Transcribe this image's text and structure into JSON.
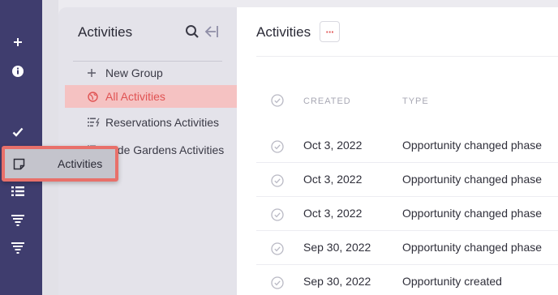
{
  "rail": {
    "icons": [
      "plus-icon",
      "info-icon",
      "check-icon",
      "note-icon",
      "list-icon",
      "filter-icon",
      "filter-icon"
    ]
  },
  "sidebar": {
    "title": "Activities",
    "items": [
      {
        "icon": "plus-icon",
        "label": "New Group"
      },
      {
        "icon": "globe-icon",
        "label": "All Activities"
      },
      {
        "icon": "list-bolt-icon",
        "label": "Reservations Activities"
      },
      {
        "icon": "list-bolt-icon",
        "label": "Jade Gardens Activities"
      }
    ]
  },
  "main": {
    "title": "Activities",
    "more_label": "···",
    "columns": {
      "created": "CREATED",
      "type": "TYPE"
    },
    "rows": [
      {
        "created": "Oct 3, 2022",
        "type": "Opportunity changed phase"
      },
      {
        "created": "Oct 3, 2022",
        "type": "Opportunity changed phase"
      },
      {
        "created": "Oct 3, 2022",
        "type": "Opportunity changed phase"
      },
      {
        "created": "Sep 30, 2022",
        "type": "Opportunity changed phase"
      },
      {
        "created": "Sep 30, 2022",
        "type": "Opportunity created"
      }
    ]
  },
  "tooltip": {
    "label": "Activities",
    "icon": "note-icon"
  },
  "colors": {
    "rail": "#3f3d6e",
    "accent": "#e05353",
    "active_bg": "#f5c2c2",
    "highlight_border": "#e8706a"
  }
}
